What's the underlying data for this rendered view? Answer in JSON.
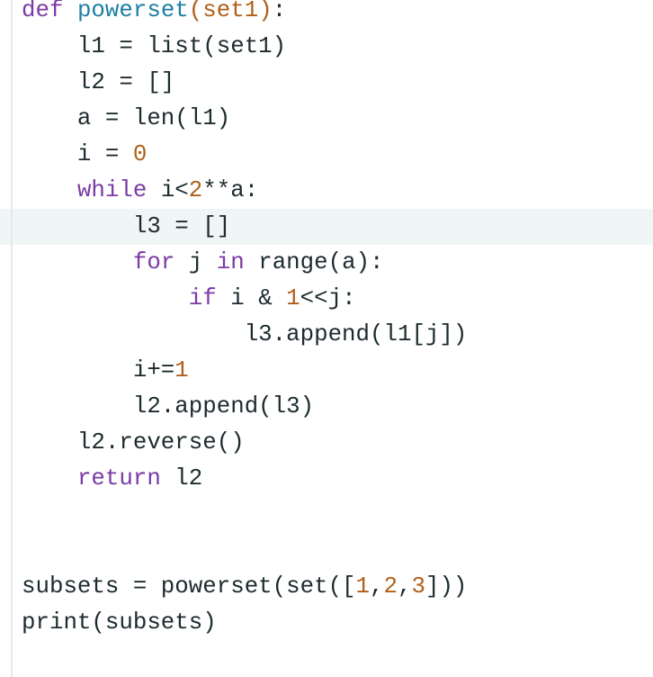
{
  "editor": {
    "language": "python",
    "active_line_index": 6,
    "colors": {
      "keyword": "#7b3aa5",
      "function_name": "#1b7fa3",
      "parameter": "#b0601a",
      "number": "#b0601a",
      "text": "#1d2b2f",
      "active_line_bg": "#f0f5f5",
      "gutter_line": "#e6e8e9"
    },
    "lines": [
      [
        {
          "t": "kw",
          "v": "def"
        },
        {
          "t": "plain",
          "v": " "
        },
        {
          "t": "fn",
          "v": "powerset"
        },
        {
          "t": "param",
          "v": "(set1)"
        },
        {
          "t": "plain",
          "v": ":"
        }
      ],
      [
        {
          "t": "plain",
          "v": "    l1 = list(set1)"
        }
      ],
      [
        {
          "t": "plain",
          "v": "    l2 = []"
        }
      ],
      [
        {
          "t": "plain",
          "v": "    a = len(l1)"
        }
      ],
      [
        {
          "t": "plain",
          "v": "    i = "
        },
        {
          "t": "num",
          "v": "0"
        }
      ],
      [
        {
          "t": "plain",
          "v": "    "
        },
        {
          "t": "kw",
          "v": "while"
        },
        {
          "t": "plain",
          "v": " i<"
        },
        {
          "t": "num",
          "v": "2"
        },
        {
          "t": "plain",
          "v": "**a:"
        }
      ],
      [
        {
          "t": "plain",
          "v": "        l3 = []"
        }
      ],
      [
        {
          "t": "plain",
          "v": "        "
        },
        {
          "t": "kw",
          "v": "for"
        },
        {
          "t": "plain",
          "v": " j "
        },
        {
          "t": "kw",
          "v": "in"
        },
        {
          "t": "plain",
          "v": " range(a):"
        }
      ],
      [
        {
          "t": "plain",
          "v": "            "
        },
        {
          "t": "kw",
          "v": "if"
        },
        {
          "t": "plain",
          "v": " i & "
        },
        {
          "t": "num",
          "v": "1"
        },
        {
          "t": "plain",
          "v": "<<j:"
        }
      ],
      [
        {
          "t": "plain",
          "v": "                l3.append(l1[j])"
        }
      ],
      [
        {
          "t": "plain",
          "v": "        i+="
        },
        {
          "t": "num",
          "v": "1"
        }
      ],
      [
        {
          "t": "plain",
          "v": "        l2.append(l3)"
        }
      ],
      [
        {
          "t": "plain",
          "v": "    l2.reverse()"
        }
      ],
      [
        {
          "t": "plain",
          "v": "    "
        },
        {
          "t": "kw",
          "v": "return"
        },
        {
          "t": "plain",
          "v": " l2"
        }
      ],
      [],
      [],
      [
        {
          "t": "plain",
          "v": "subsets = powerset(set(["
        },
        {
          "t": "num",
          "v": "1"
        },
        {
          "t": "plain",
          "v": ","
        },
        {
          "t": "num",
          "v": "2"
        },
        {
          "t": "plain",
          "v": ","
        },
        {
          "t": "num",
          "v": "3"
        },
        {
          "t": "plain",
          "v": "]))"
        }
      ],
      [
        {
          "t": "plain",
          "v": "print(subsets)"
        }
      ],
      []
    ]
  }
}
